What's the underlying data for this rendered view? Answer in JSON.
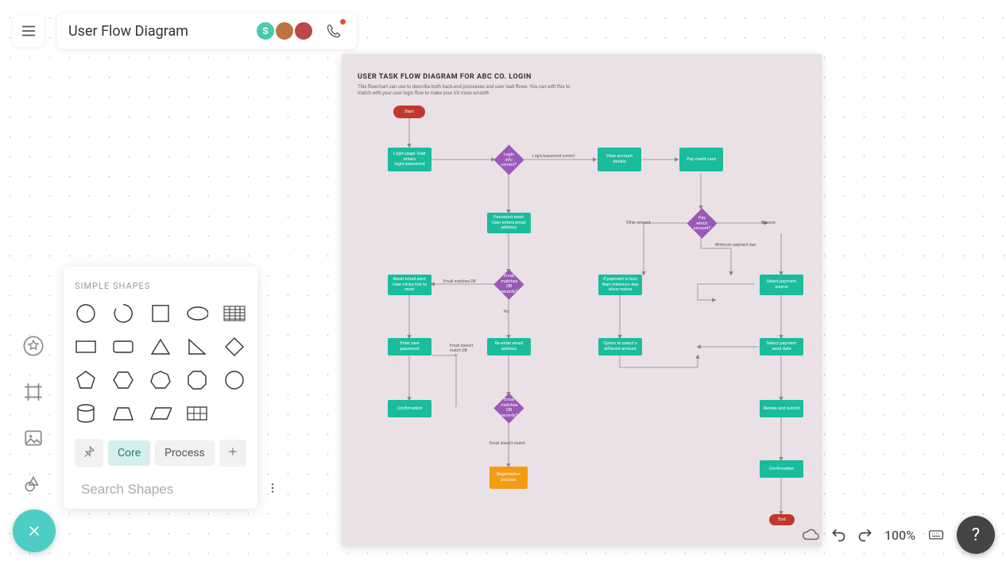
{
  "header": {
    "title": "User Flow Diagram",
    "avatars": [
      {
        "label": "S",
        "bg": "#48c9b0"
      },
      {
        "label": "",
        "bg": "#e67e22"
      },
      {
        "label": "",
        "bg": "#c0392b"
      }
    ]
  },
  "shapes_panel": {
    "title": "SIMPLE SHAPES",
    "tabs": {
      "core": "Core",
      "process": "Process"
    },
    "search_placeholder": "Search Shapes"
  },
  "canvas": {
    "title": "USER TASK FLOW DIAGRAM FOR ABC CO. LOGIN",
    "subtitle": "This flowchart can use to describe both back-end processes and user task flows. You can edit this to match with your user login flow to make your UX more smooth",
    "nodes": {
      "start": "Start",
      "login_page": "Login page: User enters login/password",
      "login_valid": "Login info correct?",
      "view_account": "View account details",
      "pay_card": "Pay credit card",
      "pwd_reset": "Password reset: User enters email address",
      "email_match": "Email matches DB records?",
      "reset_email": "Reset email sent: User clicks link to reset",
      "reenter_email": "Re-enter email address",
      "enter_pwd": "Enter new password",
      "confirmation1": "Confirmation",
      "email_match2": "Email matches DB records?",
      "reg_process": "Registration process",
      "pay_which": "Pay which amount?",
      "if_min": "If payment is less than minimum due show notice",
      "option_diff": "Option to select a different amount",
      "select_src": "Select payment source",
      "select_date": "Select payment send date",
      "review": "Review and submit",
      "confirmation2": "Confirmation",
      "end": "End"
    },
    "edge_labels": {
      "login_correct": "Login/password correct",
      "other_amount": "Other amount",
      "balance": "Balance",
      "min_pay": "Minimum payment due",
      "email_matches_db": "Email matches DB",
      "no": "No",
      "no_match": "Email doesn't match DB",
      "no_match2": "Email doesn't match"
    }
  },
  "footer": {
    "zoom": "100%"
  }
}
